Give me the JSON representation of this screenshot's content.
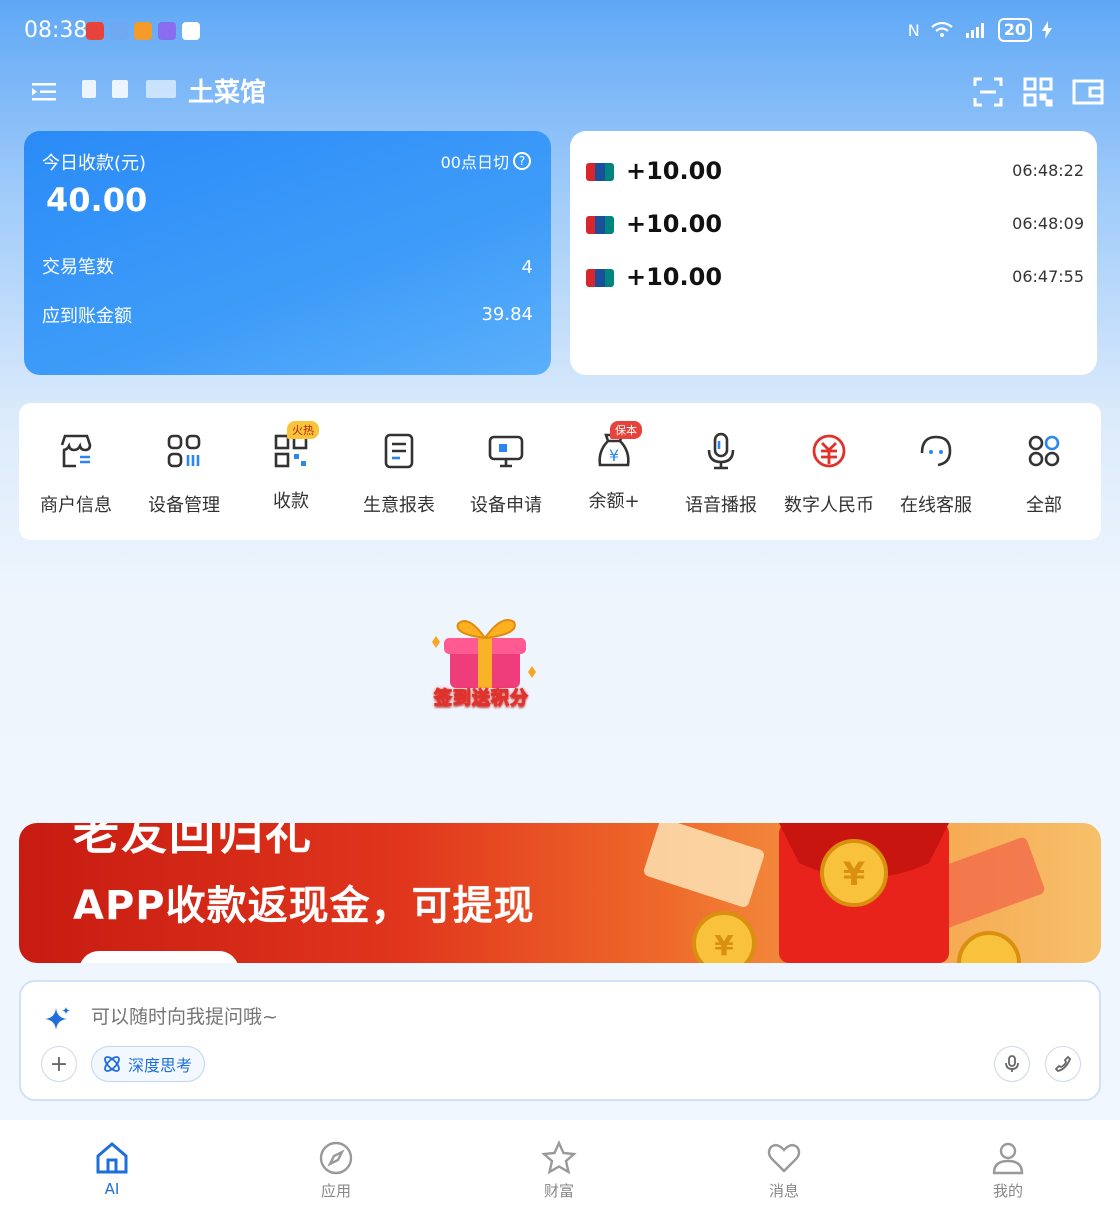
{
  "status_bar": {
    "time": "08:38",
    "battery": "20"
  },
  "header": {
    "shop_name": "湘土菜馆",
    "shop_name_visible": "∞土菜馆"
  },
  "today": {
    "title": "今日收款(元)",
    "cutoff": "00点日切",
    "amount": "40.00",
    "tx_count_label": "交易笔数",
    "tx_count": "4",
    "settle_label": "应到账金额",
    "settle_amount": "39.84"
  },
  "transactions": [
    {
      "amount": "+10.00",
      "time": "06:48:22"
    },
    {
      "amount": "+10.00",
      "time": "06:48:09"
    },
    {
      "amount": "+10.00",
      "time": "06:47:55"
    }
  ],
  "quick_menu": [
    {
      "label": "商户信息",
      "icon": "store-icon"
    },
    {
      "label": "设备管理",
      "icon": "device-grid-icon"
    },
    {
      "label": "收款",
      "icon": "qr-code-icon",
      "badge": "火热"
    },
    {
      "label": "生意报表",
      "icon": "report-icon"
    },
    {
      "label": "设备申请",
      "icon": "monitor-icon"
    },
    {
      "label": "余额+",
      "icon": "money-bag-icon",
      "badge": "保本"
    },
    {
      "label": "语音播报",
      "icon": "microphone-icon"
    },
    {
      "label": "数字人民币",
      "icon": "digital-rmb-icon"
    },
    {
      "label": "在线客服",
      "icon": "customer-service-icon"
    },
    {
      "label": "全部",
      "icon": "all-apps-icon"
    }
  ],
  "gift": {
    "label": "签到送积分"
  },
  "banner": {
    "top_text": "老友回归礼",
    "main_text": "APP收款返现金，可提现"
  },
  "ask": {
    "placeholder": "可以随时向我提问哦~",
    "deep_think": "深度思考"
  },
  "tabs": [
    {
      "label": "AI",
      "active": true
    },
    {
      "label": "应用",
      "active": false
    },
    {
      "label": "财富",
      "active": false
    },
    {
      "label": "消息",
      "active": false
    },
    {
      "label": "我的",
      "active": false
    }
  ],
  "colors": {
    "accent": "#1e6fd9",
    "card_blue": "#3e9cf8",
    "badge_red": "#e0322c",
    "badge_yellow": "#f9c43a"
  }
}
